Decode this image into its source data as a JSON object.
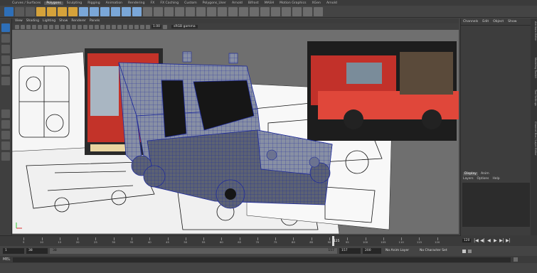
{
  "shelf_tabs": [
    "Curves / Surfaces",
    "Polygons",
    "Sculpting",
    "Rigging",
    "Animation",
    "Rendering",
    "FX",
    "FX Caching",
    "Custom",
    "Polygons_User",
    "Arnold",
    "Bifrost",
    "MASH",
    "Motion Graphics",
    "XGen",
    "Arnold"
  ],
  "active_shelf": "Polygons",
  "viewport_menu": [
    "View",
    "Shading",
    "Lighting",
    "Show",
    "Renderer",
    "Panels"
  ],
  "viewport_toolbar": {
    "exposure": "1.00",
    "gamma_label": "sRGB gamma"
  },
  "channel_box_menu": [
    "Channels",
    "Edit",
    "Object",
    "Show"
  ],
  "side_tabs": [
    "Attribute Editor",
    "Modeling Toolkit",
    "Tool Settings",
    "Channel Box / Layer Editor"
  ],
  "layer_editor": {
    "tabs": [
      "Display",
      "Anim"
    ],
    "active_tab": "Display",
    "menu": [
      "Layers",
      "Options",
      "Help"
    ]
  },
  "time_slider": {
    "ticks": [
      "5",
      "10",
      "15",
      "20",
      "25",
      "30",
      "35",
      "40",
      "45",
      "50",
      "55",
      "60",
      "65",
      "70",
      "75",
      "80",
      "85",
      "90",
      "95",
      "100",
      "105",
      "110",
      "115",
      "120"
    ],
    "current_frame": "125",
    "end_frame": "120"
  },
  "playback_buttons": [
    "|◀",
    "◀|",
    "◀",
    "▶",
    "▶|",
    "▶|"
  ],
  "range_slider": {
    "start_frame": "1",
    "range_start": "38",
    "range_handle_start": "38",
    "range_handle_end": "157",
    "range_end": "157",
    "end": "200",
    "anim_layer": "No Anim Layer",
    "character_set": "No Character Set"
  },
  "command_line": {
    "label": "MEL"
  },
  "colors": {
    "accent": "#e4a93a",
    "viewport_bg": "#6f6f6f",
    "panel_bg": "#3d3d3d",
    "truck_red": "#e0302a"
  }
}
